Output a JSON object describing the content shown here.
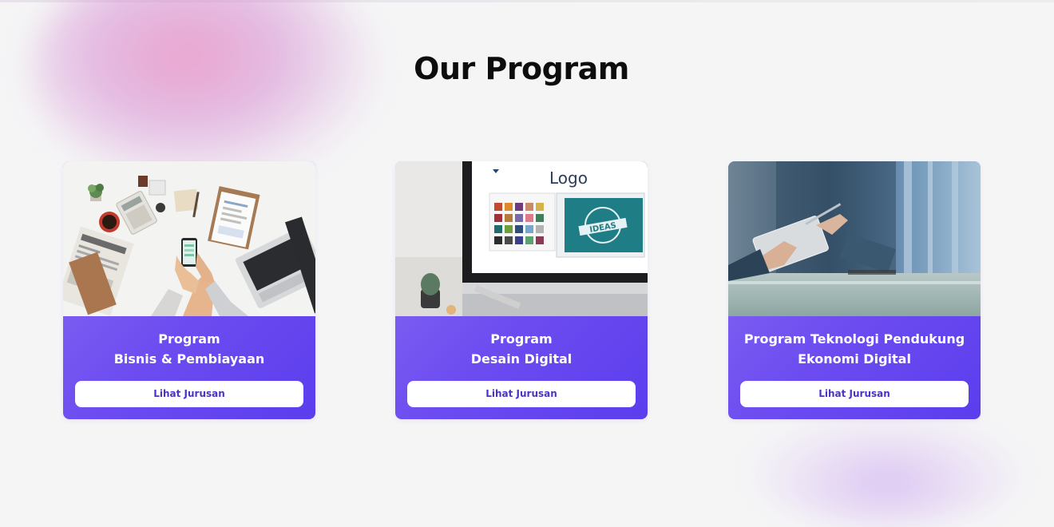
{
  "section": {
    "title": "Our Program"
  },
  "programs": [
    {
      "title_line1": "Program",
      "title_line2": "Bisnis & Pembiayaan",
      "button_label": "Lihat Jurusan",
      "image_subject": "business-desk-photo"
    },
    {
      "title_line1": "Program",
      "title_line2": "Desain Digital",
      "button_label": "Lihat Jurusan",
      "image_subject": "design-monitor-photo",
      "image_text": {
        "logo": "Logo",
        "ideas": "IDEAS"
      }
    },
    {
      "title_line1": "Program Teknologi Pendukung",
      "title_line2": "Ekonomi Digital",
      "button_label": "Lihat Jurusan",
      "image_subject": "businessman-tablet-photo"
    }
  ],
  "colors": {
    "background": "#f5f5f6",
    "card_gradient_start": "#8a6ef3",
    "card_gradient_end": "#5b3ded",
    "button_text": "#4a33c7",
    "title_text": "#0d0d0d"
  }
}
